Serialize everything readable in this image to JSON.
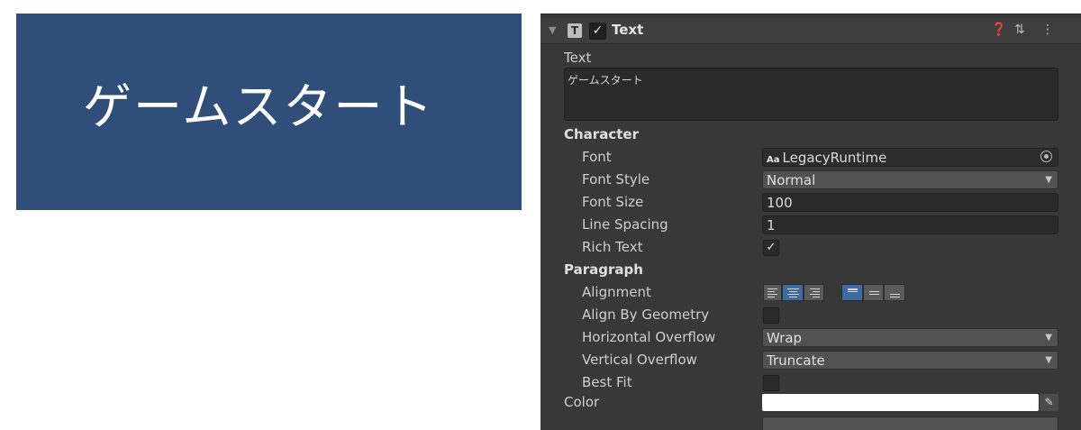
{
  "preview": {
    "text": "ゲームスタート",
    "background": "#2f4f7a"
  },
  "component": {
    "title": "Text",
    "icon": "text-component-icon",
    "enabled": true,
    "header_icons": [
      "help-icon",
      "preset-icon",
      "more-menu-icon"
    ]
  },
  "text_field": {
    "label": "Text",
    "value": "ゲームスタート"
  },
  "character": {
    "section": "Character",
    "font_label": "Font",
    "font_value": "LegacyRuntime",
    "font_badge": "Aa",
    "font_style_label": "Font Style",
    "font_style_value": "Normal",
    "font_size_label": "Font Size",
    "font_size_value": "100",
    "line_spacing_label": "Line Spacing",
    "line_spacing_value": "1",
    "rich_text_label": "Rich Text",
    "rich_text_checked": true
  },
  "paragraph": {
    "section": "Paragraph",
    "alignment_label": "Alignment",
    "alignment_horizontal": [
      "left",
      "center",
      "right"
    ],
    "alignment_horizontal_selected": "center",
    "alignment_vertical": [
      "upper",
      "middle",
      "lower"
    ],
    "alignment_vertical_selected": "upper",
    "align_by_geometry_label": "Align By Geometry",
    "align_by_geometry_checked": false,
    "horizontal_overflow_label": "Horizontal Overflow",
    "horizontal_overflow_value": "Wrap",
    "vertical_overflow_label": "Vertical Overflow",
    "vertical_overflow_value": "Truncate",
    "best_fit_label": "Best Fit",
    "best_fit_checked": false
  },
  "color": {
    "label": "Color",
    "value": "#FFFFFF"
  },
  "colors": {
    "inspector_bg": "#383838",
    "field_bg": "#2a2a2a",
    "dropdown_bg": "#515151",
    "active_button": "#3f6aa0"
  }
}
